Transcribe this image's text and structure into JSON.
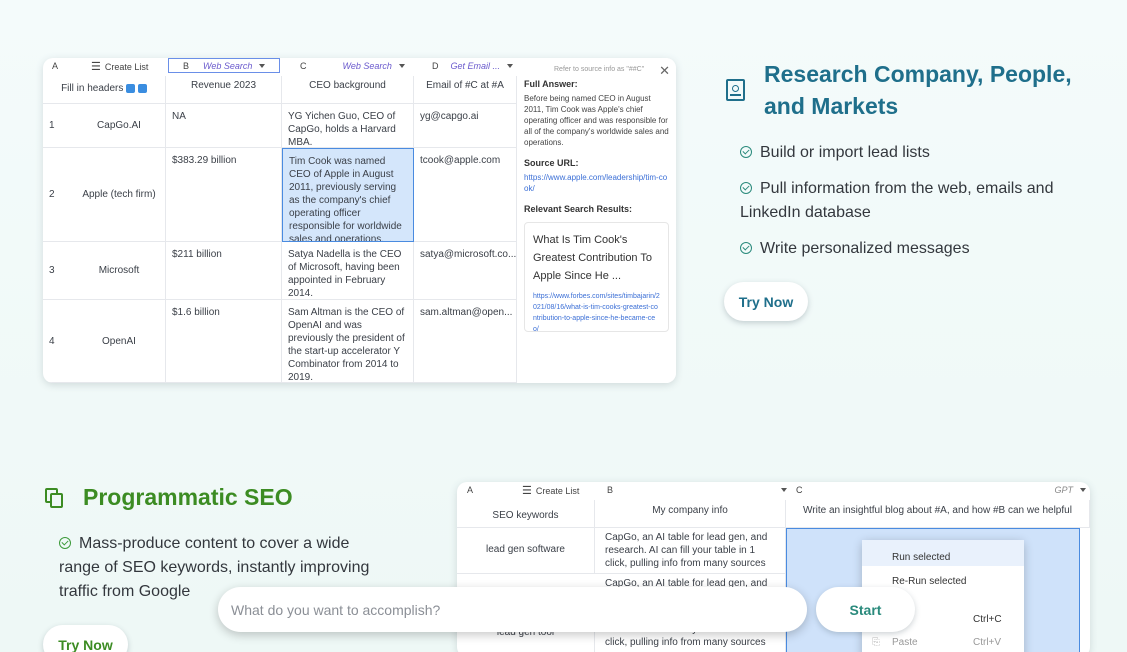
{
  "section1": {
    "title_line1": "Research Company, People,",
    "title_line2": "and Markets",
    "bullets": [
      "Build or import lead lists",
      "Pull information from the web, emails and",
      "LinkedIn database",
      "Write personalized messages"
    ],
    "button": "Try Now",
    "icon": "building-icon"
  },
  "sheet1": {
    "col_a": "A",
    "create_list": "Create List",
    "col_b": "B",
    "col_b_tag": "Web Search",
    "col_c": "C",
    "col_c_tag": "Web Search",
    "col_d": "D",
    "col_d_tag": "Get Email ...",
    "fill_headers": "Fill in headers",
    "h_revenue": "Revenue 2023",
    "h_ceo": "CEO background",
    "h_email": "Email of #C at #A",
    "rows": [
      {
        "n": "1",
        "company": "CapGo.AI",
        "revenue": "NA",
        "ceo": "YG Yichen Guo, CEO of CapGo, holds a Harvard MBA.",
        "email": "yg@capgo.ai"
      },
      {
        "n": "2",
        "company": "Apple (tech firm)",
        "revenue": "$383.29 billion",
        "ceo": "Tim Cook was named CEO of Apple in August 2011, previously serving as the company's chief operating officer responsible for worldwide sales and operations.",
        "email": "tcook@apple.com"
      },
      {
        "n": "3",
        "company": "Microsoft",
        "revenue": "$211 billion",
        "ceo": "Satya Nadella is the CEO of Microsoft, having been appointed in February 2014.",
        "email": "satya@microsoft.co..."
      },
      {
        "n": "4",
        "company": "OpenAI",
        "revenue": "$1.6 billion",
        "ceo": "Sam Altman is the CEO of OpenAI and was previously the president of the start-up accelerator Y Combinator from 2014 to 2019.",
        "email": "sam.altman@open..."
      }
    ],
    "panel": {
      "hint": "Refer to source info as \"##C\"",
      "full_answer_label": "Full Answer:",
      "full_answer": "Before being named CEO in August 2011, Tim Cook was Apple's chief operating officer and was responsible for all of the company's worldwide sales and operations.",
      "source_label": "Source URL:",
      "source_url": "https://www.apple.com/leadership/tim-cook/",
      "results_label": "Relevant Search Results:",
      "result_title": "What Is Tim Cook's Greatest Contribution To Apple Since He ...",
      "result_url": "https://www.forbes.com/sites/timbajarin/2021/08/16/what-is-tim-cooks-greatest-contribution-to-apple-since-he-became-ceo/"
    }
  },
  "section2": {
    "title": "Programmatic SEO",
    "bullet_l1": "Mass-produce content to cover a wide",
    "bullet_l2": "range of SEO keywords, instantly improving",
    "bullet_l3": "traffic from Google",
    "button": "Try Now",
    "icon": "copy-icon"
  },
  "sheet2": {
    "col_a": "A",
    "create_list": "Create List",
    "col_b": "B",
    "col_c": "C",
    "col_c_tag": "GPT",
    "h_a": "SEO keywords",
    "h_b": "My company info",
    "h_c": "Write an insightful blog about #A, and how #B can we helpful",
    "row1_a": "lead gen software",
    "row1_b": "CapGo, an AI table for lead gen, and research. AI can fill your table in 1 click, pulling info from many sources",
    "row2_b": "CapGo, an AI table for lead gen, and",
    "row3_a": "lead gen tool",
    "row3_b": "research. AI can fill your table in 1 click, pulling info from many sources",
    "menu": {
      "run": "Run selected",
      "rerun": "Re-Run selected",
      "copy_key": "Ctrl+C",
      "paste": "Paste",
      "paste_key": "Ctrl+V"
    }
  },
  "prompt": {
    "placeholder": "What do you want to accomplish?",
    "start": "Start"
  },
  "colors": {
    "teal": "#1f6f8b",
    "green": "#3c8c23",
    "selection": "#cfe2fa"
  }
}
